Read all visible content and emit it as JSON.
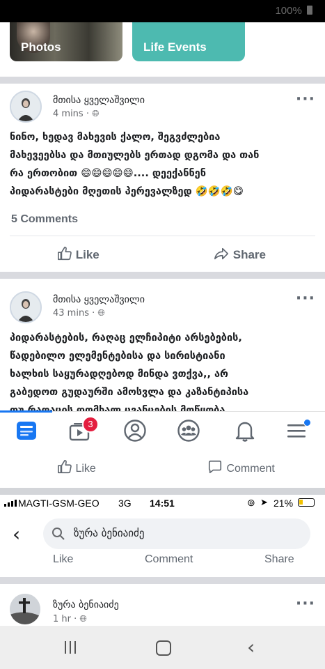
{
  "system_bar": {
    "battery": "100%"
  },
  "profile_tiles": {
    "photos": "Photos",
    "life_events": "Life Events"
  },
  "posts": [
    {
      "author": "მთისა ყველაშვილი",
      "time": "4 mins",
      "lines": [
        "ნინო, ხედავ მახევის ქალო, შეგვძლებია",
        "მახევეებსა და მთიულებს ერთად დგომა და თან",
        "რა ერთობით 😄😄😄😄😄.... დეექანნენ",
        "პიდარასტები მღეთის პერევალზედ 🤣🤣🤣😋"
      ],
      "comments": "5 Comments",
      "like": "Like",
      "share": "Share"
    },
    {
      "author": "მთისა ყველაშვილი",
      "time": "43 mins",
      "lines": [
        "პიდარასტების, რაღაც ელჩიპიტი არსებების,",
        "წადებილო ელემენტებისა და სირისტიანი",
        "ხალხის საყურადღებოდ მინდა ვთქვა,, არ",
        "გაბედოთ გუდაურში ამოსვლა და კაზანტიპისა",
        "თუ რაღაცის დომხალ ცვანცების მოწყობა"
      ]
    }
  ],
  "bottom_nav": {
    "video_badge": "3"
  },
  "second_actions": {
    "like": "Like",
    "comment": "Comment"
  },
  "status_bar": {
    "carrier": "MAGTI-GSM-GEO",
    "network": "3G",
    "time": "14:51",
    "battery": "21%"
  },
  "search": {
    "query": "ზურა ბენიაიძე"
  },
  "third_actions": {
    "like": "Like",
    "comment": "Comment",
    "share": "Share"
  },
  "third_post": {
    "author": "ზურა ბენიაიძე",
    "time": "1 hr"
  }
}
